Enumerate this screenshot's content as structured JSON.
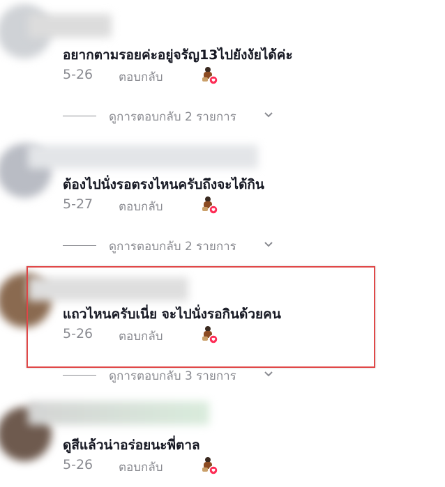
{
  "comments": [
    {
      "text": "อยากตามรอยค่ะอยู่จรัญ13ไปยังงัยได้ค่ะ",
      "date": "5-26",
      "reply_label": "ตอบกลับ",
      "view_replies": "ดูการตอบกลับ 2 รายการ"
    },
    {
      "text": "ต้องไปนั่งรอตรงไหนครับถึงจะได้กิน",
      "date": "5-27",
      "reply_label": "ตอบกลับ",
      "view_replies": "ดูการตอบกลับ 2 รายการ"
    },
    {
      "text": "แถวไหนครับเนี่ย จะไปนั่งรอกินด้วยคน",
      "date": "5-26",
      "reply_label": "ตอบกลับ",
      "view_replies": "ดูการตอบกลับ 3 รายการ"
    },
    {
      "text": "ดูสีแล้วน่าอร่อยนะพี่ตาล",
      "date": "5-26",
      "reply_label": "ตอบกลับ"
    }
  ],
  "icons": {
    "creator_liked": "creator-liked-heart-icon",
    "expand": "chevron-down-icon"
  },
  "colors": {
    "text_primary": "#161823",
    "text_secondary": "#8a8b91",
    "heart": "#fe2c55",
    "highlight_border": "#e04848"
  }
}
